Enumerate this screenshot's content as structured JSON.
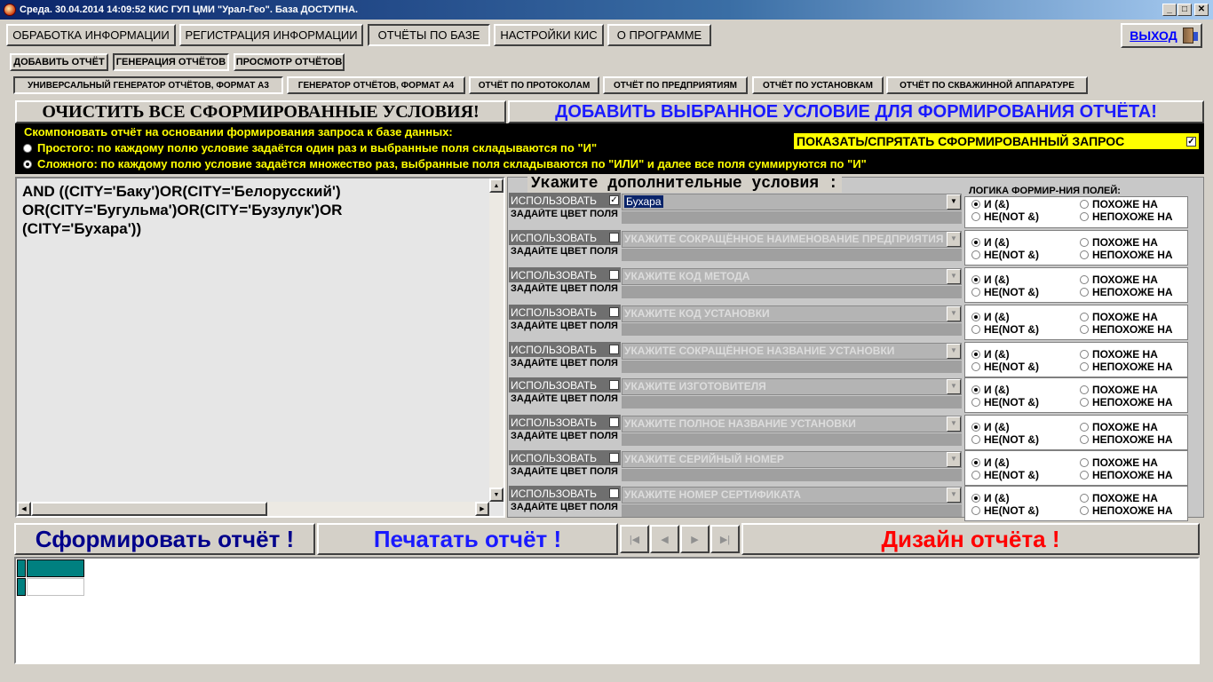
{
  "window": {
    "title": "Среда. 30.04.2014 14:09:52  КИС ГУП ЦМИ \"Урал-Гео\". База ДОСТУПНА.",
    "min": "_",
    "max": "□",
    "close": "✕"
  },
  "menu": {
    "items": [
      "ОБРАБОТКА ИНФОРМАЦИИ",
      "РЕГИСТРАЦИЯ ИНФОРМАЦИИ",
      "ОТЧЁТЫ ПО БАЗЕ",
      "НАСТРОЙКИ КИС",
      "О ПРОГРАММЕ"
    ],
    "exit": "ВЫХОД"
  },
  "subtabs": [
    "ДОБАВИТЬ ОТЧЁТ",
    "ГЕНЕРАЦИЯ ОТЧЁТОВ",
    "ПРОСМОТР ОТЧЁТОВ"
  ],
  "gentabs": [
    "УНИВЕРСАЛЬНЫЙ ГЕНЕРАТОР ОТЧЁТОВ, ФОРМАТ А3",
    "ГЕНЕРАТОР ОТЧЁТОВ, ФОРМАТ А4",
    "ОТЧЁТ ПО ПРОТОКОЛАМ",
    "ОТЧЁТ ПО ПРЕДПРИЯТИЯМ",
    "ОТЧЁТ ПО УСТАНОВКАМ",
    "ОТЧЁТ ПО СКВАЖИННОЙ АППАРАТУРЕ"
  ],
  "actions": {
    "clear": "ОЧИСТИТЬ ВСЕ СФОРМИРОВАННЫЕ УСЛОВИЯ!",
    "add": "ДОБАВИТЬ ВЫБРАННОЕ УСЛОВИЕ ДЛЯ ФОРМИРОВАНИЯ  ОТЧЁТА!"
  },
  "mode": {
    "heading": "Скомпоновать отчёт на основании формирования запроса к базе данных:",
    "simple": "Простого: по каждому полю условие задаётся один раз и выбранные поля складываются по \"И\"",
    "complex": "Сложного: по каждому полю условие задаётся множество раз, выбранные поля складываются по \"ИЛИ\" и далее все поля суммируются по \"И\"",
    "toggle": "ПОКАЗАТЬ/СПРЯТАТЬ СФОРМИРОВАННЫЙ ЗАПРОС",
    "toggle_checked": "✓"
  },
  "query": {
    "text": "AND ((CITY='Баку')OR(CITY='Белорусский')\nOR(CITY='Бугульма')OR(CITY='Бузулук')OR\n(CITY='Бухара'))"
  },
  "conditions": {
    "heading": "Укажите дополнительные условия :",
    "logic_heading": "ЛОГИКА ФОРМИР-НИЯ ПОЛЕЙ:",
    "use": "ИСПОЛЬЗОВАТЬ",
    "color": "ЗАДАЙТЕ ЦВЕТ ПОЛЯ",
    "logic": {
      "and": "И     (&)",
      "not": "НЕ(NOT &)",
      "like": "ПОХОЖЕ НА",
      "notlike": "НЕПОХОЖЕ НА"
    },
    "rows": [
      {
        "value": "Бухара",
        "checked": "✓"
      },
      {
        "value": "УКАЖИТЕ СОКРАЩЁННОЕ НАИМЕНОВАНИЕ ПРЕДПРИЯТИЯ",
        "checked": ""
      },
      {
        "value": "УКАЖИТЕ КОД МЕТОДА",
        "checked": ""
      },
      {
        "value": "УКАЖИТЕ КОД УСТАНОВКИ",
        "checked": ""
      },
      {
        "value": "УКАЖИТЕ СОКРАЩЁННОЕ НАЗВАНИЕ УСТАНОВКИ",
        "checked": ""
      },
      {
        "value": "УКАЖИТЕ ИЗГОТОВИТЕЛЯ",
        "checked": ""
      },
      {
        "value": "УКАЖИТЕ ПОЛНОЕ НАЗВАНИЕ УСТАНОВКИ",
        "checked": ""
      },
      {
        "value": "УКАЖИТЕ СЕРИЙНЫЙ НОМЕР",
        "checked": ""
      },
      {
        "value": "УКАЖИТЕ НОМЕР СЕРТИФИКАТА",
        "checked": ""
      }
    ]
  },
  "bottom": {
    "form": "Сформировать отчёт !",
    "print": "Печатать отчёт !",
    "design": "Дизайн отчёта !",
    "nav": [
      "|◀",
      "◀",
      "▶",
      "▶|"
    ]
  },
  "colors": {
    "accent_blue": "#1a1aff",
    "dark_blue": "#00008b",
    "red": "#ff0000",
    "yellow": "#ffff00",
    "teal": "#008080"
  }
}
